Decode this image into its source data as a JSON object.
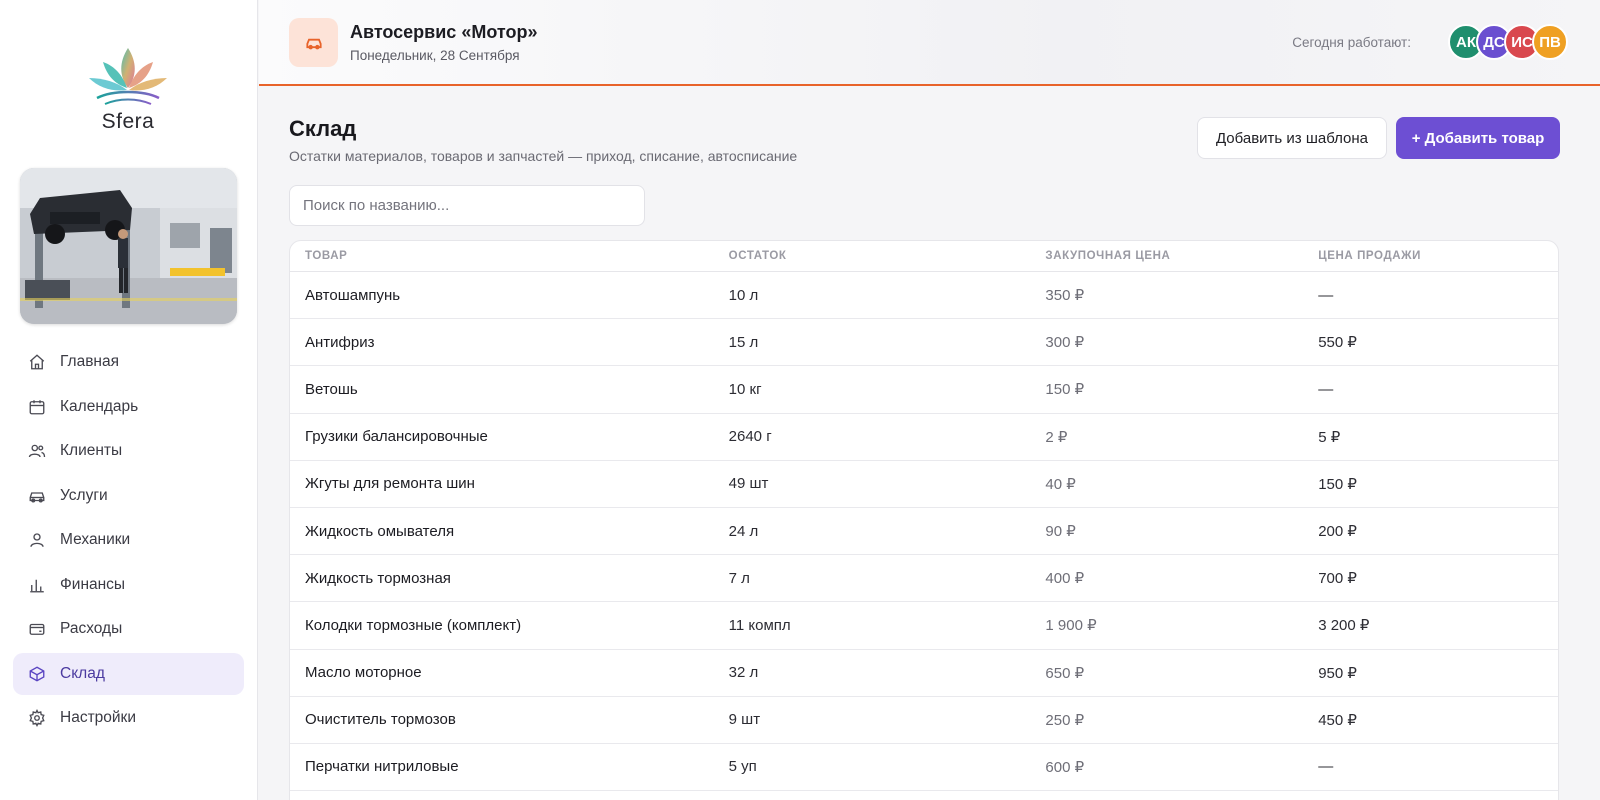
{
  "sidebar": {
    "logo_text": "Sfera",
    "nav": [
      {
        "label": "Главная",
        "icon": "home-icon"
      },
      {
        "label": "Календарь",
        "icon": "calendar-icon"
      },
      {
        "label": "Клиенты",
        "icon": "users-icon"
      },
      {
        "label": "Услуги",
        "icon": "car-icon"
      },
      {
        "label": "Механики",
        "icon": "user-icon"
      },
      {
        "label": "Финансы",
        "icon": "bar-chart-icon"
      },
      {
        "label": "Расходы",
        "icon": "wallet-icon"
      },
      {
        "label": "Склад",
        "icon": "box-icon",
        "active": true
      },
      {
        "label": "Настройки",
        "icon": "gear-icon"
      }
    ]
  },
  "header": {
    "title": "Автосервис «Мотор»",
    "date": "Понедельник, 28 Сентября",
    "working_label": "Сегодня работают:",
    "avatars": [
      {
        "initials": "АК",
        "color": "#1f8f6e"
      },
      {
        "initials": "ДС",
        "color": "#6a4fd0"
      },
      {
        "initials": "ИС",
        "color": "#d9484e"
      },
      {
        "initials": "ПВ",
        "color": "#efa023"
      }
    ],
    "accent_color": "#e8632a"
  },
  "page": {
    "title": "Склад",
    "subtitle": "Остатки материалов, товаров и запчастей — приход, списание, автосписание",
    "add_from_template": "Добавить из шаблона",
    "add_item": "+ Добавить товар",
    "search_placeholder": "Поиск по названию..."
  },
  "table": {
    "columns": [
      "Товар",
      "Остаток",
      "Закупочная цена",
      "Цена продажи"
    ],
    "rows": [
      {
        "name": "Автошампунь",
        "stock": "10 л",
        "purchase": "350 ₽",
        "sale": "—"
      },
      {
        "name": "Антифриз",
        "stock": "15 л",
        "purchase": "300 ₽",
        "sale": "550 ₽"
      },
      {
        "name": "Ветошь",
        "stock": "10 кг",
        "purchase": "150 ₽",
        "sale": "—"
      },
      {
        "name": "Грузики балансировочные",
        "stock": "2640 г",
        "purchase": "2 ₽",
        "sale": "5 ₽"
      },
      {
        "name": "Жгуты для ремонта шин",
        "stock": "49 шт",
        "purchase": "40 ₽",
        "sale": "150 ₽"
      },
      {
        "name": "Жидкость омывателя",
        "stock": "24 л",
        "purchase": "90 ₽",
        "sale": "200 ₽"
      },
      {
        "name": "Жидкость тормозная",
        "stock": "7 л",
        "purchase": "400 ₽",
        "sale": "700 ₽"
      },
      {
        "name": "Колодки тормозные (комплект)",
        "stock": "11 компл",
        "purchase": "1 900 ₽",
        "sale": "3 200 ₽"
      },
      {
        "name": "Масло моторное",
        "stock": "32 л",
        "purchase": "650 ₽",
        "sale": "950 ₽"
      },
      {
        "name": "Очиститель тормозов",
        "stock": "9 шт",
        "purchase": "250 ₽",
        "sale": "450 ₽"
      },
      {
        "name": "Перчатки нитриловые",
        "stock": "5 уп",
        "purchase": "600 ₽",
        "sale": "—"
      },
      {
        "name": "",
        "stock": "",
        "purchase": "",
        "sale": ""
      }
    ]
  }
}
